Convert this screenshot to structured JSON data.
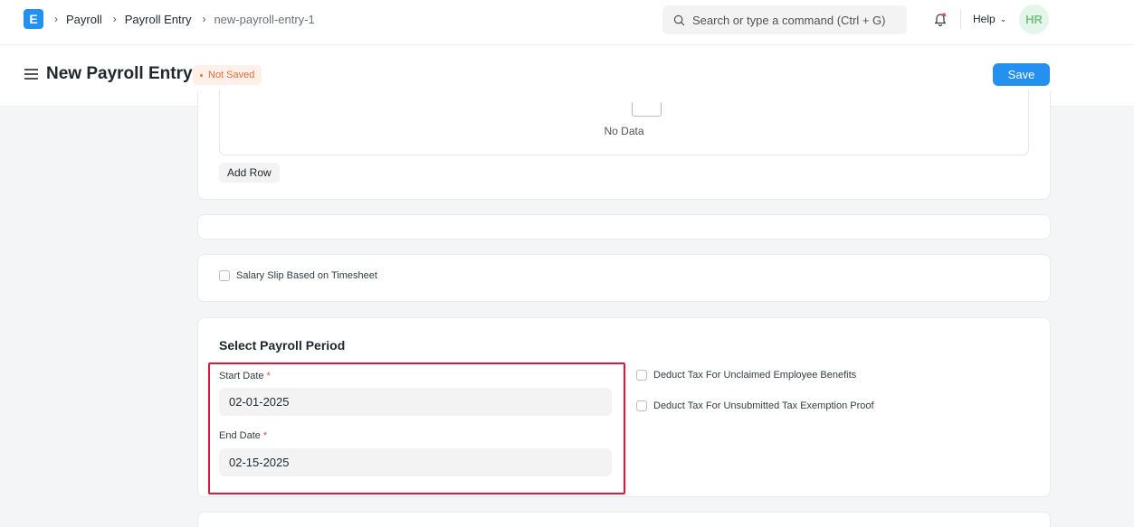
{
  "navbar": {
    "logo_letter": "E",
    "breadcrumbs": [
      "Payroll",
      "Payroll Entry",
      "new-payroll-entry-1"
    ],
    "search_placeholder": "Search or type a command (Ctrl + G)",
    "help_label": "Help",
    "avatar_initials": "HR"
  },
  "header": {
    "title": "New Payroll Entry",
    "status": "Not Saved",
    "save_label": "Save"
  },
  "table": {
    "no_data_text": "No Data",
    "add_row_label": "Add Row"
  },
  "timesheet": {
    "checkbox_label": "Salary Slip Based on Timesheet"
  },
  "payroll_period": {
    "section_title": "Select Payroll Period",
    "start_date_label": "Start Date",
    "start_date_value": "02-01-2025",
    "end_date_label": "End Date",
    "end_date_value": "02-15-2025",
    "required_mark": "*",
    "deduct_unclaimed_label": "Deduct Tax For Unclaimed Employee Benefits",
    "deduct_unsubmitted_label": "Deduct Tax For Unsubmitted Tax Exemption Proof"
  },
  "colors": {
    "primary": "#2490ef",
    "highlight": "#e0173c",
    "status": "#e86c3a"
  }
}
